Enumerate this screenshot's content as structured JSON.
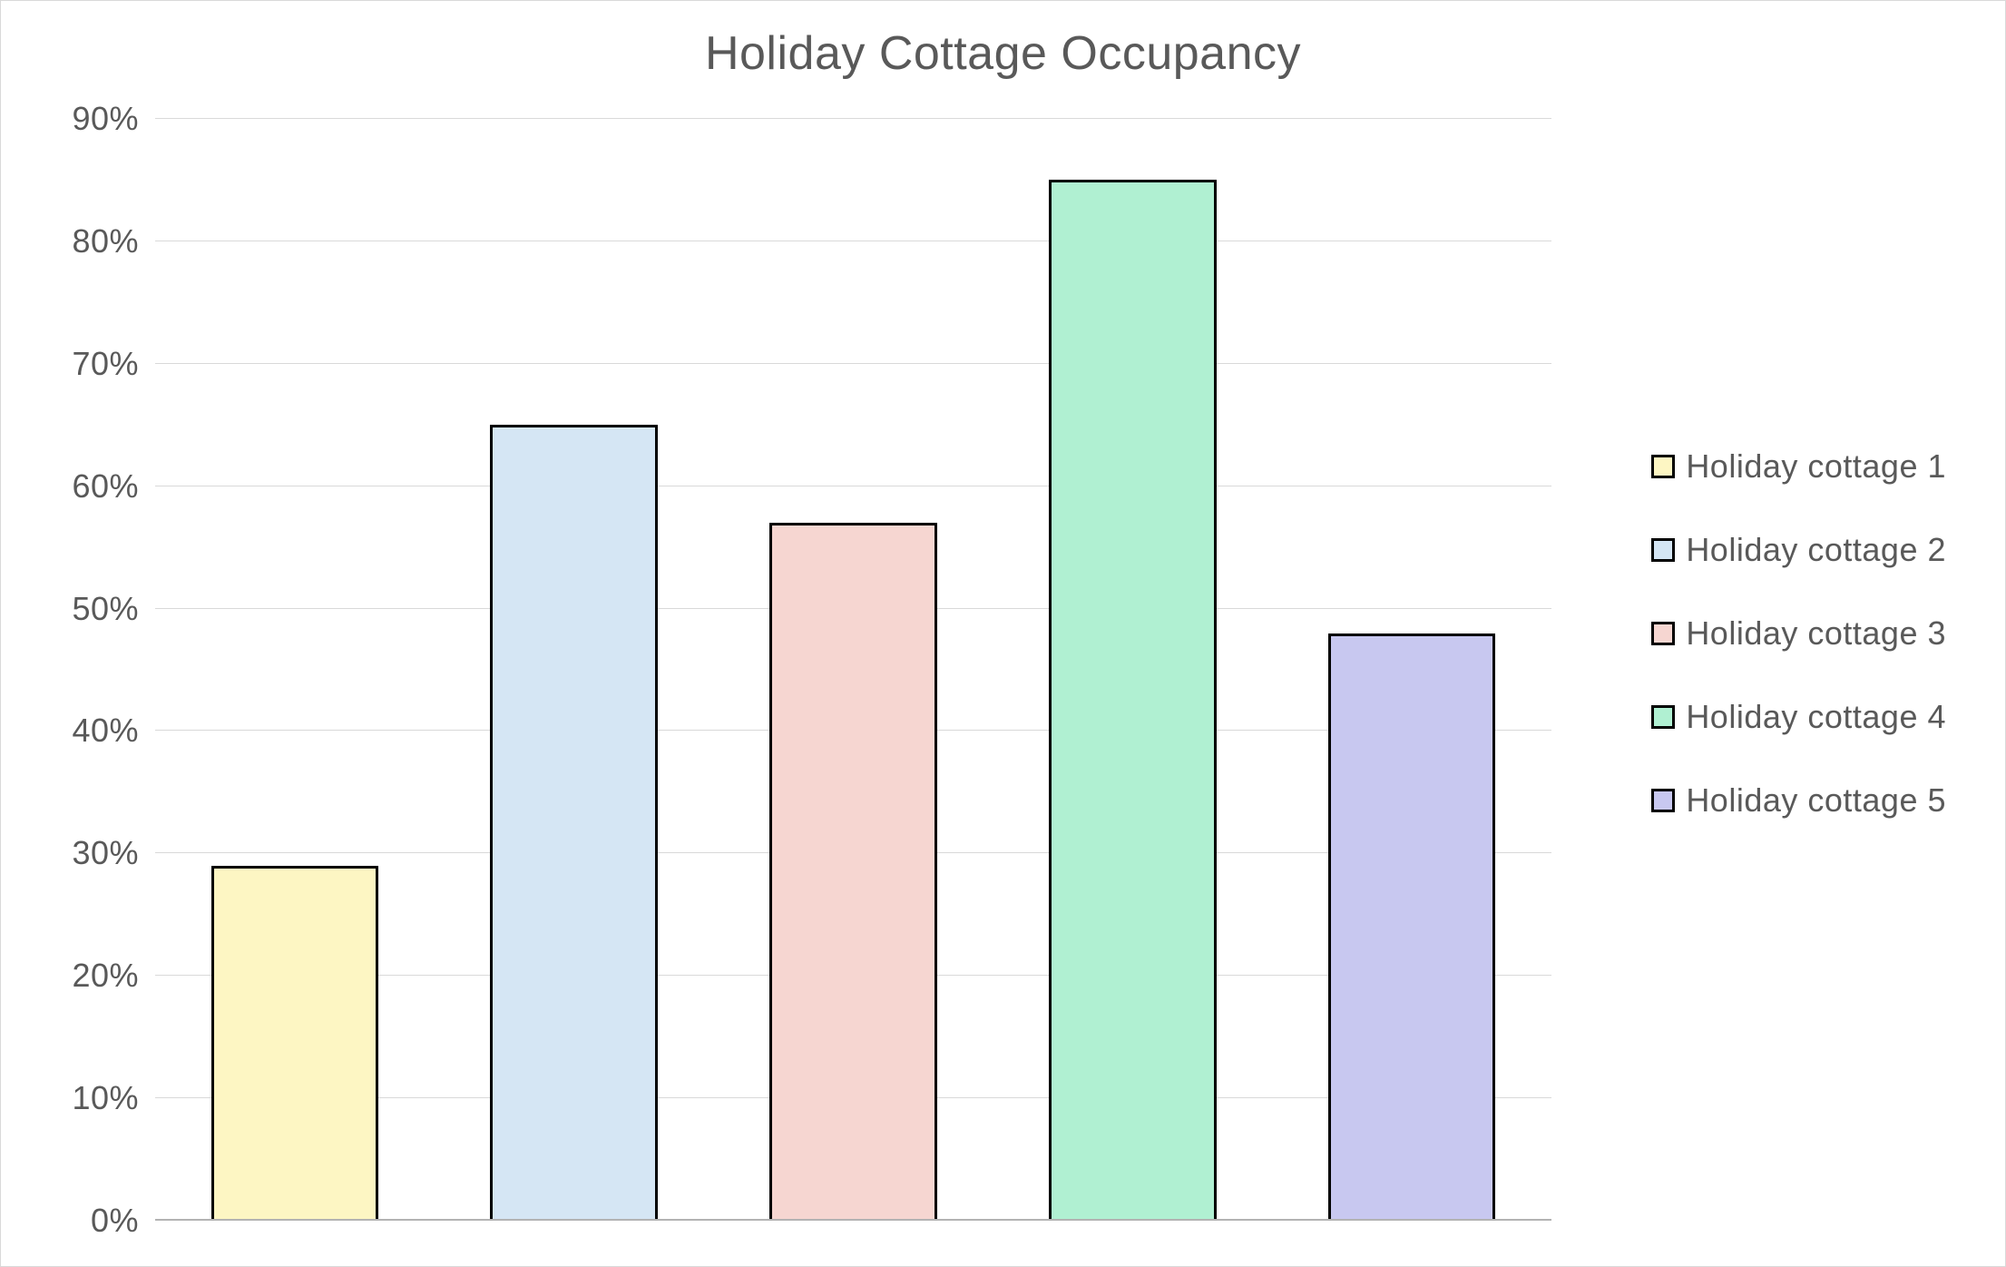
{
  "chart_data": {
    "type": "bar",
    "title": "Holiday Cottage Occupancy",
    "ylabel": "",
    "xlabel": "",
    "ylim": [
      0,
      90
    ],
    "y_ticks": [
      0,
      10,
      20,
      30,
      40,
      50,
      60,
      70,
      80,
      90
    ],
    "y_tick_labels": [
      "0%",
      "10%",
      "20%",
      "30%",
      "40%",
      "50%",
      "60%",
      "70%",
      "80%",
      "90%"
    ],
    "categories": [
      "Holiday cottage 1",
      "Holiday cottage 2",
      "Holiday cottage 3",
      "Holiday cottage 4",
      "Holiday cottage 5"
    ],
    "values": [
      29,
      65,
      57,
      85,
      48
    ],
    "series_colors": [
      "#fdf6c3",
      "#d5e6f4",
      "#f6d6d1",
      "#b0f0d2",
      "#c8c8f0"
    ],
    "legend_labels": [
      "Holiday cottage 1",
      "Holiday cottage 2",
      "Holiday cottage 3",
      "Holiday cottage 4",
      "Holiday cottage 5"
    ]
  }
}
